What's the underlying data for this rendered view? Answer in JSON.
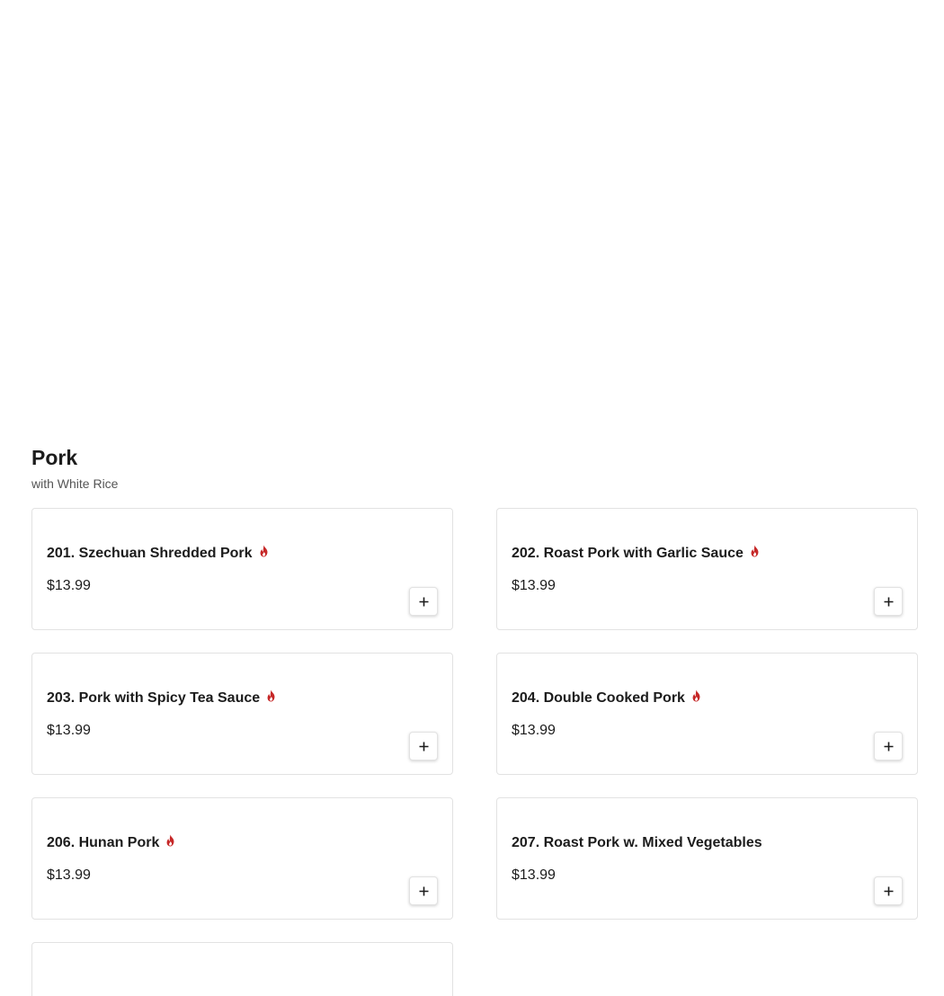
{
  "section": {
    "title": "Pork",
    "subtitle": "with White Rice"
  },
  "items": [
    {
      "name": "201. Szechuan Shredded Pork",
      "price": "$13.99",
      "spicy": true
    },
    {
      "name": "202. Roast Pork with Garlic Sauce",
      "price": "$13.99",
      "spicy": true
    },
    {
      "name": "203. Pork with Spicy Tea Sauce",
      "price": "$13.99",
      "spicy": true
    },
    {
      "name": "204. Double Cooked Pork",
      "price": "$13.99",
      "spicy": true
    },
    {
      "name": "206. Hunan Pork",
      "price": "$13.99",
      "spicy": true
    },
    {
      "name": "207. Roast Pork w. Mixed Vegetables",
      "price": "$13.99",
      "spicy": false
    }
  ],
  "icons": {
    "spicy": "flame-icon",
    "add": "plus-icon"
  },
  "colors": {
    "spicy": "#c62828",
    "text": "#1c1c1c",
    "border": "#e2e2e2"
  }
}
